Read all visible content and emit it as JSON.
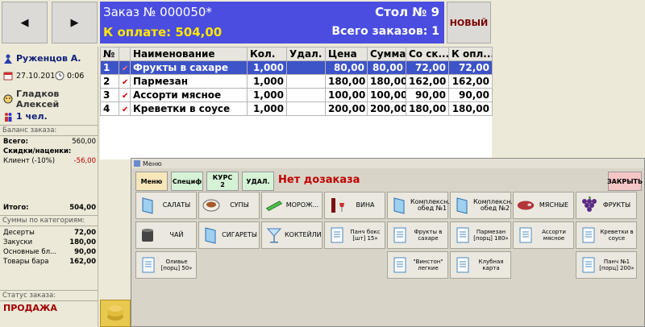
{
  "nav": {
    "prev": "◀",
    "next": "▶"
  },
  "order": {
    "title": "Заказ № 000050*",
    "table_label": "Стол № 9",
    "to_pay": "К оплате: 504,00",
    "total_orders": "Всего заказов: 1",
    "new_button": "НОВЫЙ"
  },
  "info": {
    "waiter": "Руженцов А.",
    "date": "27.10.2011",
    "time": "0:06",
    "guest": "Гладков Алексей",
    "people": "1 чел."
  },
  "balance": {
    "label": "Баланс заказа:",
    "total_label": "Всего:",
    "total_value": "560,00",
    "discounts_label": "Скидки/наценки:",
    "client_label": "Клиент (-10%)",
    "client_value": "-56,00",
    "result_label": "Итого:",
    "result_value": "504,00"
  },
  "categories_sum": {
    "label": "Суммы по категориям:",
    "rows": [
      {
        "name": "Десерты",
        "value": "72,00"
      },
      {
        "name": "Закуски",
        "value": "180,00"
      },
      {
        "name": "Основные бл...",
        "value": "90,00"
      },
      {
        "name": "Товары бара",
        "value": "162,00"
      }
    ]
  },
  "status": {
    "label": "Статус заказа:",
    "value": "ПРОДАЖА"
  },
  "table": {
    "headers": [
      "№",
      "",
      "Наименование",
      "Кол.",
      "Удал.",
      "Цена",
      "Сумма",
      "Со ск...",
      "К опл..."
    ],
    "rows": [
      {
        "n": "1",
        "name": "Фрукты в сахаре",
        "qty": "1,000",
        "del": "",
        "price": "80,00",
        "sum": "80,00",
        "disc": "72,00",
        "pay": "72,00"
      },
      {
        "n": "2",
        "name": "Пармезан",
        "qty": "1,000",
        "del": "",
        "price": "180,00",
        "sum": "180,00",
        "disc": "162,00",
        "pay": "162,00"
      },
      {
        "n": "3",
        "name": "Ассорти мясное",
        "qty": "1,000",
        "del": "",
        "price": "100,00",
        "sum": "100,00",
        "disc": "90,00",
        "pay": "90,00"
      },
      {
        "n": "4",
        "name": "Креветки в соусе",
        "qty": "1,000",
        "del": "",
        "price": "200,00",
        "sum": "200,00",
        "disc": "180,00",
        "pay": "180,00"
      }
    ]
  },
  "menu": {
    "window_title": "Меню",
    "tabs": {
      "menu": "Меню",
      "spec": "Специф",
      "course_line1": "КУРС",
      "course_line2": "2",
      "del": "УДАЛ."
    },
    "no_extra": "Нет дозаказа",
    "close": "ЗАКРЫТЬ",
    "tiles": {
      "salads": "САЛАТЫ",
      "soups": "СУПЫ",
      "icecream": "МОРОЖ...",
      "wines": "ВИНА",
      "combo1": "Комплексн... обед №1",
      "combo2": "Комплексн... обед №2",
      "meat": "МЯСНЫЕ",
      "fruits": "ФРУКТЫ",
      "tea": "ЧАЙ",
      "cigarettes": "СИГАРЕТЫ",
      "cocktails": "КОКТЕЙЛИ",
      "punch": "Панч бокс [шт] 15»",
      "fruitsugar": "Фрукты в сахаре",
      "parmesan": "Пармезан [порц] 180»",
      "assorti": "Ассорти мясное",
      "shrimp": "Креветки в соусе",
      "olivier": "Оливье [порц] 50»",
      "winston": "\"Винстон\" легкие",
      "clubcard": "Клубная карта",
      "punch1": "Панч №1 [порц] 200»"
    }
  }
}
